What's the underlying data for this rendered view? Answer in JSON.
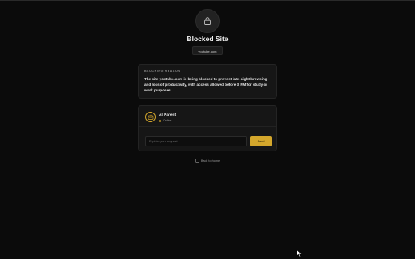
{
  "page": {
    "title": "Blocked Site",
    "domain": "youtube.com",
    "icon": "lock-icon"
  },
  "reason": {
    "label": "BLOCKING REASON",
    "text": "The site youtube.com is being blocked to prevent late-night browsing and loss of productivity, with access allowed before 3 PM for study or work purposes."
  },
  "chat": {
    "name": "AI Parent",
    "status": "Online",
    "placeholder": "Explain your request...",
    "send_label": "Send"
  },
  "back": {
    "label": "Back to home"
  },
  "colors": {
    "background": "#0b0b0b",
    "card": "#161616",
    "accent": "#d4a72c"
  }
}
